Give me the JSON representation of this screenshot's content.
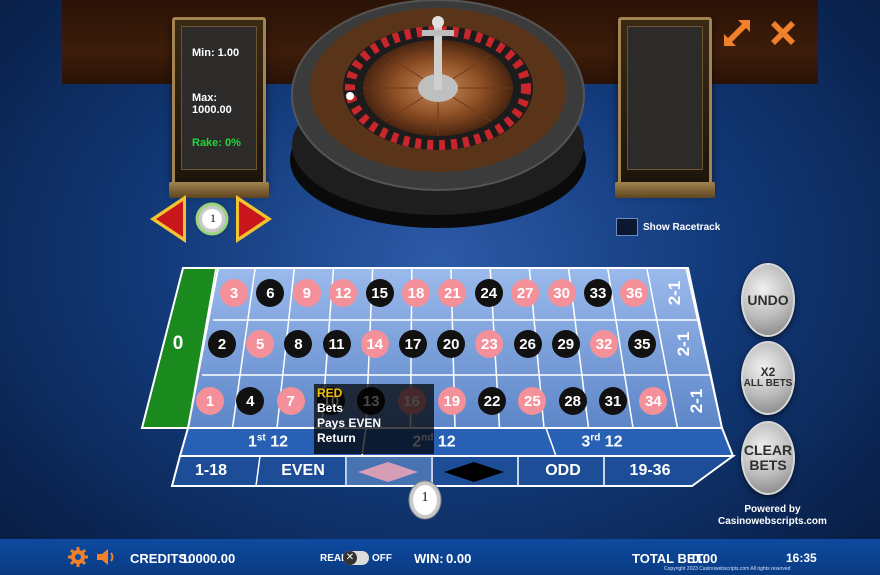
{
  "limits": {
    "min": "Min: 1.00",
    "max": "Max: 1000.00",
    "rake": "Rake: 0%"
  },
  "chip_selector": {
    "value": "1"
  },
  "racetrack": {
    "label": "Show Racetrack"
  },
  "table": {
    "zero": "0",
    "rows": [
      [
        {
          "n": "3",
          "c": "red"
        },
        {
          "n": "6",
          "c": "black"
        },
        {
          "n": "9",
          "c": "red"
        },
        {
          "n": "12",
          "c": "red"
        },
        {
          "n": "15",
          "c": "black"
        },
        {
          "n": "18",
          "c": "red"
        },
        {
          "n": "21",
          "c": "red"
        },
        {
          "n": "24",
          "c": "black"
        },
        {
          "n": "27",
          "c": "red"
        },
        {
          "n": "30",
          "c": "red"
        },
        {
          "n": "33",
          "c": "black"
        },
        {
          "n": "36",
          "c": "red"
        }
      ],
      [
        {
          "n": "2",
          "c": "black"
        },
        {
          "n": "5",
          "c": "red"
        },
        {
          "n": "8",
          "c": "black"
        },
        {
          "n": "11",
          "c": "black"
        },
        {
          "n": "14",
          "c": "red"
        },
        {
          "n": "17",
          "c": "black"
        },
        {
          "n": "20",
          "c": "black"
        },
        {
          "n": "23",
          "c": "red"
        },
        {
          "n": "26",
          "c": "black"
        },
        {
          "n": "29",
          "c": "black"
        },
        {
          "n": "32",
          "c": "red"
        },
        {
          "n": "35",
          "c": "black"
        }
      ],
      [
        {
          "n": "1",
          "c": "red"
        },
        {
          "n": "4",
          "c": "black"
        },
        {
          "n": "7",
          "c": "red"
        },
        {
          "n": "10",
          "c": "black"
        },
        {
          "n": "13",
          "c": "black"
        },
        {
          "n": "16",
          "c": "red"
        },
        {
          "n": "19",
          "c": "red"
        },
        {
          "n": "22",
          "c": "black"
        },
        {
          "n": "25",
          "c": "red"
        },
        {
          "n": "28",
          "c": "black"
        },
        {
          "n": "31",
          "c": "black"
        },
        {
          "n": "34",
          "c": "red"
        }
      ]
    ],
    "columns": [
      "2-1",
      "2-1",
      "2-1"
    ],
    "dozens": [
      {
        "num": "1",
        "sup": "st",
        "label": "12"
      },
      {
        "num": "2",
        "sup": "nd",
        "label": "12"
      },
      {
        "num": "3",
        "sup": "rd",
        "label": "12"
      }
    ],
    "outside": {
      "low": "1-18",
      "even": "EVEN",
      "odd": "ODD",
      "high": "19-36"
    }
  },
  "tooltip": {
    "line1": "RED",
    "line2": "Bets",
    "line3": "Pays EVEN",
    "line4": "Return"
  },
  "buttons": {
    "undo": "UNDO",
    "x2_line1": "X2",
    "x2_line2": "ALL BETS",
    "clear_line1": "CLEAR",
    "clear_line2": "BETS"
  },
  "chip_on_table": "1",
  "powered": {
    "line1": "Powered by",
    "line2": "Casinowebscripts.com"
  },
  "bottom": {
    "credits_label": "CREDITS:",
    "credits_value": "10000.00",
    "real": "REAL",
    "off": "OFF",
    "win_label": "WIN:",
    "win_value": "0.00",
    "total_label": "TOTAL BET:",
    "total_value": "0.00",
    "clock": "16:35",
    "copyright": "Copyright 2023 Casinowebscripts.com All rights reserved"
  },
  "colors": {
    "red_slot": "#f4909a",
    "black_slot": "#111111",
    "felt": "#8fb1e6",
    "zero_green": "#1a8a1f",
    "bar": "#0d4aa0",
    "accent_orange": "#f0802a"
  },
  "icons": [
    "fullscreen-icon",
    "close-icon",
    "arrow-left-icon",
    "arrow-right-icon",
    "gear-icon",
    "speaker-icon",
    "toggle-x-icon",
    "chip-icon"
  ]
}
